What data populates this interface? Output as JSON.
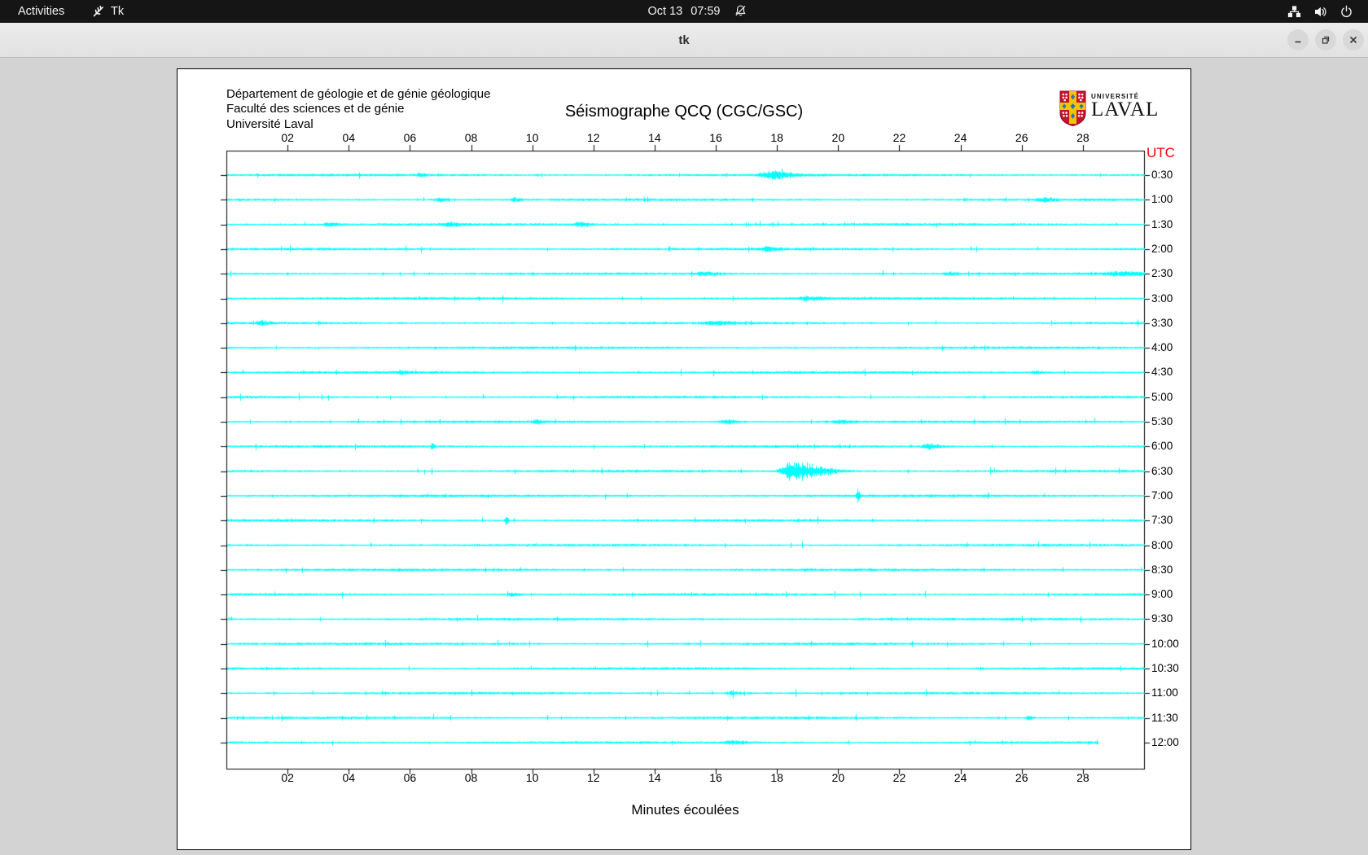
{
  "top_bar": {
    "activities_label": "Activities",
    "app_name": "Tk",
    "date": "Oct 13",
    "time": "07:59",
    "icons": [
      "tk-feather-icon",
      "bell-slash-icon",
      "network-icon",
      "volume-icon",
      "power-icon"
    ]
  },
  "window": {
    "title": "tk",
    "controls": [
      "minimize",
      "maximize",
      "close"
    ]
  },
  "seismograph": {
    "header_lines": [
      "Département de géologie et de génie géologique",
      "Faculté des sciences et de génie",
      "Université Laval"
    ],
    "title": "Séismographe QCQ (CGC/GSC)",
    "utc_label": "UTC",
    "x_caption": "Minutes écoulées",
    "logo": {
      "line1": "UNIVERSITÉ",
      "line2": "LAVAL"
    }
  },
  "chart_data": {
    "type": "line",
    "title": "Séismographe QCQ (CGC/GSC)",
    "station": "QCQ",
    "agency": "CGC/GSC",
    "xlabel": "Minutes écoulées",
    "x_range": [
      0,
      30
    ],
    "x_ticks": [
      "02",
      "04",
      "06",
      "08",
      "10",
      "12",
      "14",
      "16",
      "18",
      "20",
      "22",
      "24",
      "26",
      "28"
    ],
    "trace_interval_minutes": 30,
    "trace_labels": [
      "0:30",
      "1:00",
      "1:30",
      "2:00",
      "2:30",
      "3:00",
      "3:30",
      "4:00",
      "4:30",
      "5:00",
      "5:30",
      "6:00",
      "6:30",
      "7:00",
      "7:30",
      "8:00",
      "8:30",
      "9:00",
      "9:30",
      "10:00",
      "10:30",
      "11:00",
      "11:30",
      "12:00"
    ],
    "trace_color": "#00ffff",
    "axis_color": "#000000",
    "utc_label_color": "#ff0000",
    "last_trace_end_minute": 28.5,
    "events": [
      {
        "trace": "0:30",
        "minute": 6.3,
        "amp": 2.5,
        "rise": 0.06,
        "decay": 0.12
      },
      {
        "trace": "0:30",
        "minute": 17.8,
        "amp": 4.5,
        "rise": 0.25,
        "decay": 0.5
      },
      {
        "trace": "1:00",
        "minute": 6.9,
        "amp": 2.6,
        "rise": 0.1,
        "decay": 0.2
      },
      {
        "trace": "1:00",
        "minute": 9.4,
        "amp": 2.0,
        "rise": 0.08,
        "decay": 0.15
      },
      {
        "trace": "1:00",
        "minute": 26.6,
        "amp": 2.4,
        "rise": 0.1,
        "decay": 0.3
      },
      {
        "trace": "1:30",
        "minute": 3.3,
        "amp": 2.6,
        "rise": 0.1,
        "decay": 0.25
      },
      {
        "trace": "1:30",
        "minute": 7.2,
        "amp": 3.0,
        "rise": 0.12,
        "decay": 0.25
      },
      {
        "trace": "1:30",
        "minute": 11.5,
        "amp": 2.6,
        "rise": 0.1,
        "decay": 0.2
      },
      {
        "trace": "2:00",
        "minute": 17.6,
        "amp": 2.4,
        "rise": 0.1,
        "decay": 0.3
      },
      {
        "trace": "2:30",
        "minute": 15.6,
        "amp": 2.0,
        "rise": 0.2,
        "decay": 0.4
      },
      {
        "trace": "2:30",
        "minute": 23.6,
        "amp": 2.0,
        "rise": 0.1,
        "decay": 0.2
      },
      {
        "trace": "2:30",
        "minute": 29.3,
        "amp": 2.4,
        "rise": 0.5,
        "decay": 0.8
      },
      {
        "trace": "3:00",
        "minute": 18.9,
        "amp": 2.4,
        "rise": 0.2,
        "decay": 0.4
      },
      {
        "trace": "3:30",
        "minute": 1.1,
        "amp": 2.6,
        "rise": 0.08,
        "decay": 0.2
      },
      {
        "trace": "3:30",
        "minute": 16.0,
        "amp": 2.0,
        "rise": 0.3,
        "decay": 0.5
      },
      {
        "trace": "4:30",
        "minute": 5.7,
        "amp": 2.6,
        "rise": 0.08,
        "decay": 0.15
      },
      {
        "trace": "4:30",
        "minute": 26.4,
        "amp": 2.0,
        "rise": 0.1,
        "decay": 0.2
      },
      {
        "trace": "5:30",
        "minute": 10.1,
        "amp": 3.0,
        "rise": 0.08,
        "decay": 0.15
      },
      {
        "trace": "5:30",
        "minute": 16.3,
        "amp": 2.4,
        "rise": 0.15,
        "decay": 0.3
      },
      {
        "trace": "5:30",
        "minute": 20.0,
        "amp": 2.4,
        "rise": 0.15,
        "decay": 0.3
      },
      {
        "trace": "6:00",
        "minute": 6.7,
        "amp": 5.5,
        "rise": 0.03,
        "decay": 0.05
      },
      {
        "trace": "6:00",
        "minute": 22.9,
        "amp": 3.0,
        "rise": 0.15,
        "decay": 0.3
      },
      {
        "trace": "6:30",
        "minute": 18.45,
        "amp": 11.5,
        "rise": 0.22,
        "decay": 0.85
      },
      {
        "trace": "7:00",
        "minute": 20.6,
        "amp": 9.5,
        "rise": 0.03,
        "decay": 0.05
      },
      {
        "trace": "7:30",
        "minute": 9.1,
        "amp": 7.0,
        "rise": 0.03,
        "decay": 0.05
      },
      {
        "trace": "9:00",
        "minute": 9.3,
        "amp": 2.0,
        "rise": 0.1,
        "decay": 0.2
      },
      {
        "trace": "11:00",
        "minute": 16.5,
        "amp": 2.0,
        "rise": 0.15,
        "decay": 0.3
      },
      {
        "trace": "11:30",
        "minute": 26.2,
        "amp": 2.4,
        "rise": 0.06,
        "decay": 0.12
      },
      {
        "trace": "12:00",
        "minute": 16.5,
        "amp": 2.0,
        "rise": 0.2,
        "decay": 0.4
      }
    ]
  }
}
